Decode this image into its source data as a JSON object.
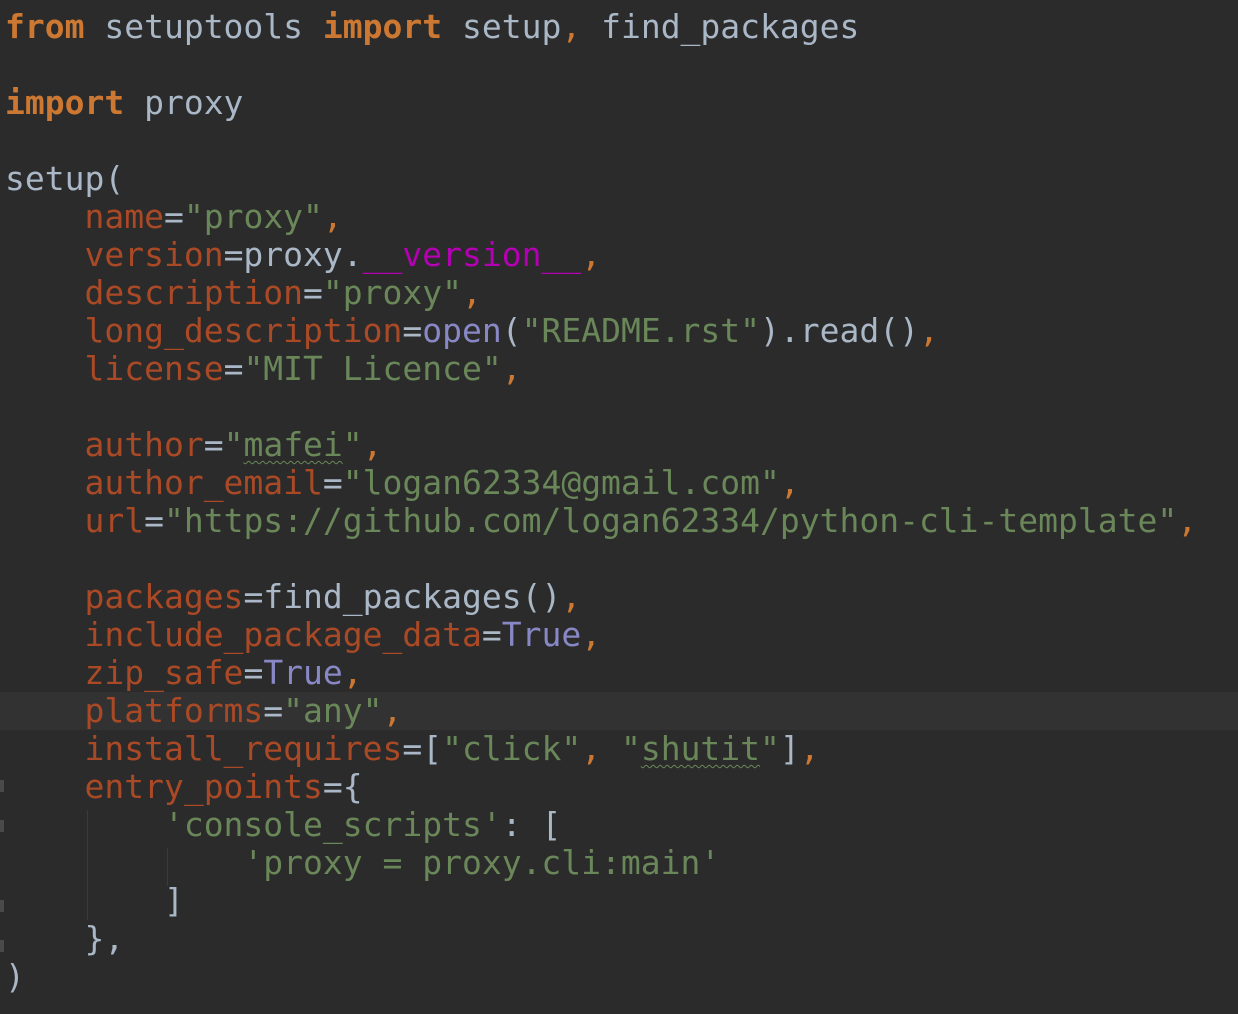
{
  "editor": {
    "language": "python",
    "colors": {
      "background": "#2b2b2b",
      "caret_line": "#323232",
      "keyword": "#cc7832",
      "parameter": "#aa4926",
      "string": "#6a8759",
      "default": "#a9b7c6",
      "magic": "#b200b2",
      "builtin": "#8888c6"
    },
    "lines": [
      [
        {
          "t": "from",
          "c": "kw"
        },
        {
          "t": " setuptools ",
          "c": "plain"
        },
        {
          "t": "import",
          "c": "kw"
        },
        {
          "t": " setup",
          "c": "plain"
        },
        {
          "t": ",",
          "c": "punct"
        },
        {
          "t": " find_packages",
          "c": "plain"
        }
      ],
      [],
      [
        {
          "t": "import",
          "c": "kw"
        },
        {
          "t": " proxy",
          "c": "plain"
        }
      ],
      [],
      [
        {
          "t": "setup(",
          "c": "plain"
        }
      ],
      [
        {
          "t": "    ",
          "c": "plain"
        },
        {
          "t": "name",
          "c": "param"
        },
        {
          "t": "=",
          "c": "plain"
        },
        {
          "t": "\"proxy\"",
          "c": "str"
        },
        {
          "t": ",",
          "c": "punct"
        }
      ],
      [
        {
          "t": "    ",
          "c": "plain"
        },
        {
          "t": "version",
          "c": "param"
        },
        {
          "t": "=proxy.",
          "c": "plain"
        },
        {
          "t": "__version__",
          "c": "magic"
        },
        {
          "t": ",",
          "c": "punct"
        }
      ],
      [
        {
          "t": "    ",
          "c": "plain"
        },
        {
          "t": "description",
          "c": "param"
        },
        {
          "t": "=",
          "c": "plain"
        },
        {
          "t": "\"proxy\"",
          "c": "str"
        },
        {
          "t": ",",
          "c": "punct"
        }
      ],
      [
        {
          "t": "    ",
          "c": "plain"
        },
        {
          "t": "long_description",
          "c": "param"
        },
        {
          "t": "=",
          "c": "plain"
        },
        {
          "t": "open",
          "c": "builtin"
        },
        {
          "t": "(",
          "c": "plain"
        },
        {
          "t": "\"README.rst\"",
          "c": "str"
        },
        {
          "t": ").read()",
          "c": "plain"
        },
        {
          "t": ",",
          "c": "punct"
        }
      ],
      [
        {
          "t": "    ",
          "c": "plain"
        },
        {
          "t": "license",
          "c": "param"
        },
        {
          "t": "=",
          "c": "plain"
        },
        {
          "t": "\"MIT Licence\"",
          "c": "str"
        },
        {
          "t": ",",
          "c": "punct"
        }
      ],
      [],
      [
        {
          "t": "    ",
          "c": "plain"
        },
        {
          "t": "author",
          "c": "param"
        },
        {
          "t": "=",
          "c": "plain"
        },
        {
          "t": "\"",
          "c": "str"
        },
        {
          "t": "mafei",
          "c": "str typo"
        },
        {
          "t": "\"",
          "c": "str"
        },
        {
          "t": ",",
          "c": "punct"
        }
      ],
      [
        {
          "t": "    ",
          "c": "plain"
        },
        {
          "t": "author_email",
          "c": "param"
        },
        {
          "t": "=",
          "c": "plain"
        },
        {
          "t": "\"logan62334@gmail.com\"",
          "c": "str"
        },
        {
          "t": ",",
          "c": "punct"
        }
      ],
      [
        {
          "t": "    ",
          "c": "plain"
        },
        {
          "t": "url",
          "c": "param"
        },
        {
          "t": "=",
          "c": "plain"
        },
        {
          "t": "\"https://github.com/logan62334/python-cli-template\"",
          "c": "str"
        },
        {
          "t": ",",
          "c": "punct"
        }
      ],
      [],
      [
        {
          "t": "    ",
          "c": "plain"
        },
        {
          "t": "packages",
          "c": "param"
        },
        {
          "t": "=find_packages()",
          "c": "plain"
        },
        {
          "t": ",",
          "c": "punct"
        }
      ],
      [
        {
          "t": "    ",
          "c": "plain"
        },
        {
          "t": "include_package_data",
          "c": "param"
        },
        {
          "t": "=",
          "c": "plain"
        },
        {
          "t": "True",
          "c": "builtin"
        },
        {
          "t": ",",
          "c": "punct"
        }
      ],
      [
        {
          "t": "    ",
          "c": "plain"
        },
        {
          "t": "zip_safe",
          "c": "param"
        },
        {
          "t": "=",
          "c": "plain"
        },
        {
          "t": "True",
          "c": "builtin"
        },
        {
          "t": ",",
          "c": "punct"
        }
      ],
      [
        {
          "t": "    ",
          "c": "plain"
        },
        {
          "t": "platforms",
          "c": "param"
        },
        {
          "t": "=",
          "c": "plain"
        },
        {
          "t": "\"any\"",
          "c": "str"
        },
        {
          "t": ",",
          "c": "punct"
        }
      ],
      [
        {
          "t": "    ",
          "c": "plain"
        },
        {
          "t": "install_requires",
          "c": "param"
        },
        {
          "t": "=[",
          "c": "plain"
        },
        {
          "t": "\"click\"",
          "c": "str"
        },
        {
          "t": ", ",
          "c": "punct"
        },
        {
          "t": "\"",
          "c": "str"
        },
        {
          "t": "shutit",
          "c": "str typo"
        },
        {
          "t": "\"",
          "c": "str"
        },
        {
          "t": "]",
          "c": "plain"
        },
        {
          "t": ",",
          "c": "punct"
        }
      ],
      [
        {
          "t": "    ",
          "c": "plain"
        },
        {
          "t": "entry_points",
          "c": "param"
        },
        {
          "t": "={",
          "c": "plain"
        }
      ],
      [
        {
          "t": "        ",
          "c": "plain"
        },
        {
          "t": "'console_scripts'",
          "c": "str"
        },
        {
          "t": ": [",
          "c": "plain"
        }
      ],
      [
        {
          "t": "            ",
          "c": "plain"
        },
        {
          "t": "'proxy = proxy.cli:main'",
          "c": "str"
        }
      ],
      [
        {
          "t": "        ]",
          "c": "plain"
        }
      ],
      [
        {
          "t": "    },",
          "c": "plain"
        }
      ],
      [
        {
          "t": ")",
          "c": "plain"
        }
      ]
    ],
    "caret_line_index": 18
  }
}
